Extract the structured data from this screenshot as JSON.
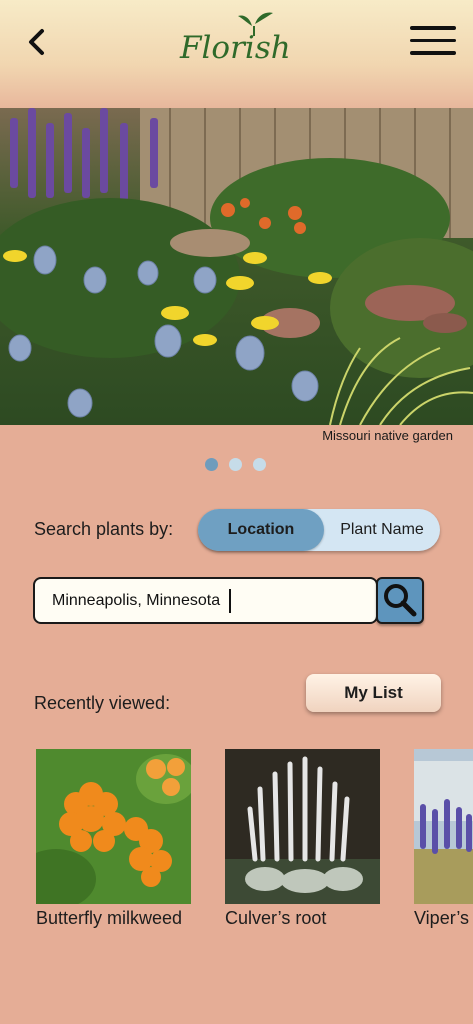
{
  "header": {
    "logo_text": "Florish",
    "back_icon": "chevron-left-icon",
    "menu_icon": "hamburger-menu-icon"
  },
  "hero": {
    "caption": "Missouri native garden",
    "carousel_active_index": 0,
    "carousel_count": 3
  },
  "search": {
    "label": "Search plants by:",
    "toggle": {
      "selected": "Location",
      "options": [
        "Location",
        "Plant Name"
      ]
    },
    "input_value": "Minneapolis, Minnesota",
    "button_icon": "search-icon"
  },
  "recent": {
    "label": "Recently viewed:",
    "my_list_label": "My List",
    "items": [
      {
        "name": "Butterfly milkweed"
      },
      {
        "name": "Culver’s root"
      },
      {
        "name": "Viper’s"
      }
    ]
  },
  "colors": {
    "background": "#e5ad96",
    "accent_blue": "#6fa0c2",
    "logo_green": "#2f6a2a"
  }
}
